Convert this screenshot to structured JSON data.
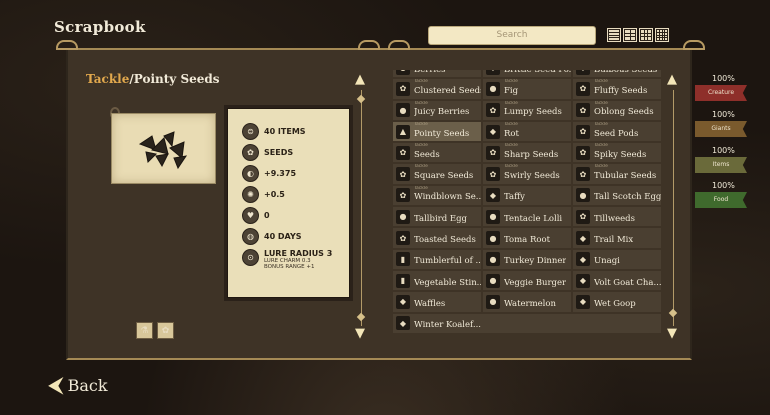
{
  "header": {
    "title": "Scrapbook",
    "search_placeholder": "Search"
  },
  "detail": {
    "category": "Tackle",
    "separator": "/",
    "name": "Pointy Seeds",
    "stats": [
      {
        "icon": "stack-icon",
        "glyph": "⊜",
        "text": "40 ITEMS"
      },
      {
        "icon": "seed-type-icon",
        "glyph": "✿",
        "text": "SEEDS"
      },
      {
        "icon": "hunger-icon",
        "glyph": "◐",
        "text": "+9.375"
      },
      {
        "icon": "sanity-icon",
        "glyph": "✺",
        "text": "+0.5"
      },
      {
        "icon": "health-icon",
        "glyph": "♥",
        "text": "0"
      },
      {
        "icon": "spoil-icon",
        "glyph": "◍",
        "text": "40 DAYS"
      }
    ],
    "lure": {
      "icon": "lure-icon",
      "glyph": "⊙",
      "text": "LURE RADIUS 3",
      "sub1": "LURE CHARM 0.3",
      "sub2": "BONUS RANGE +1"
    }
  },
  "list": {
    "tag": "Tackle",
    "items": [
      {
        "label": "Berries",
        "icon": "berries-icon",
        "glyph": "●"
      },
      {
        "label": "Brittle Seed Po...",
        "icon": "brittle-seed-pod-icon",
        "glyph": "◆"
      },
      {
        "label": "Bulbous Seeds",
        "icon": "bulbous-seeds-icon",
        "glyph": "◆"
      },
      {
        "label": "Clustered Seeds",
        "icon": "clustered-seeds-icon",
        "glyph": "✿"
      },
      {
        "label": "Fig",
        "icon": "fig-icon",
        "glyph": "●"
      },
      {
        "label": "Fluffy Seeds",
        "icon": "fluffy-seeds-icon",
        "glyph": "✿"
      },
      {
        "label": "Juicy Berries",
        "icon": "juicy-berries-icon",
        "glyph": "●"
      },
      {
        "label": "Lumpy Seeds",
        "icon": "lumpy-seeds-icon",
        "glyph": "✿"
      },
      {
        "label": "Oblong Seeds",
        "icon": "oblong-seeds-icon",
        "glyph": "✿"
      },
      {
        "label": "Pointy Seeds",
        "icon": "pointy-seeds-icon",
        "glyph": "▲",
        "selected": true
      },
      {
        "label": "Rot",
        "icon": "rot-icon",
        "glyph": "◆"
      },
      {
        "label": "Seed Pods",
        "icon": "seed-pods-icon",
        "glyph": "✿"
      },
      {
        "label": "Seeds",
        "icon": "seeds-icon",
        "glyph": "✿"
      },
      {
        "label": "Sharp Seeds",
        "icon": "sharp-seeds-icon",
        "glyph": "✿"
      },
      {
        "label": "Spiky Seeds",
        "icon": "spiky-seeds-icon",
        "glyph": "✿"
      },
      {
        "label": "Square Seeds",
        "icon": "square-seeds-icon",
        "glyph": "✿"
      },
      {
        "label": "Swirly Seeds",
        "icon": "swirly-seeds-icon",
        "glyph": "✿"
      },
      {
        "label": "Tubular Seeds",
        "icon": "tubular-seeds-icon",
        "glyph": "✿"
      },
      {
        "label": "Windblown Se...",
        "icon": "windblown-seeds-icon",
        "glyph": "✿"
      },
      {
        "label": "Taffy",
        "icon": "taffy-icon",
        "glyph": "◆",
        "no_tag": true
      },
      {
        "label": "Tall Scotch Eggs",
        "icon": "tall-scotch-eggs-icon",
        "glyph": "●",
        "no_tag": true
      },
      {
        "label": "Tallbird Egg",
        "icon": "tallbird-egg-icon",
        "glyph": "●",
        "no_tag": true
      },
      {
        "label": "Tentacle Lolli",
        "icon": "tentacle-lolli-icon",
        "glyph": "●",
        "no_tag": true
      },
      {
        "label": "Tillweeds",
        "icon": "tillweeds-icon",
        "glyph": "✿",
        "no_tag": true
      },
      {
        "label": "Toasted Seeds",
        "icon": "toasted-seeds-icon",
        "glyph": "✿",
        "no_tag": true
      },
      {
        "label": "Toma Root",
        "icon": "toma-root-icon",
        "glyph": "●",
        "no_tag": true
      },
      {
        "label": "Trail Mix",
        "icon": "trail-mix-icon",
        "glyph": "◆",
        "no_tag": true
      },
      {
        "label": "Tumblerful of ...",
        "icon": "tumblerful-icon",
        "glyph": "▮",
        "no_tag": true
      },
      {
        "label": "Turkey Dinner",
        "icon": "turkey-dinner-icon",
        "glyph": "●",
        "no_tag": true
      },
      {
        "label": "Unagi",
        "icon": "unagi-icon",
        "glyph": "◆",
        "no_tag": true
      },
      {
        "label": "Vegetable Stin...",
        "icon": "vegetable-stinger-icon",
        "glyph": "▮",
        "no_tag": true
      },
      {
        "label": "Veggie Burger",
        "icon": "veggie-burger-icon",
        "glyph": "●",
        "no_tag": true
      },
      {
        "label": "Volt Goat Cha...",
        "icon": "volt-goat-chaud-froid-icon",
        "glyph": "◆",
        "no_tag": true
      },
      {
        "label": "Waffles",
        "icon": "waffles-icon",
        "glyph": "◆",
        "no_tag": true
      },
      {
        "label": "Watermelon",
        "icon": "watermelon-icon",
        "glyph": "●",
        "no_tag": true
      },
      {
        "label": "Wet Goop",
        "icon": "wet-goop-icon",
        "glyph": "◆",
        "no_tag": true
      },
      {
        "label": "Winter Koalef...",
        "icon": "winter-koalefant-icon",
        "glyph": "◆",
        "no_tag": true,
        "wide": true
      }
    ]
  },
  "categories": [
    {
      "label": "Creature",
      "percent": "100%",
      "color": "#8e2f2a"
    },
    {
      "label": "Giants",
      "percent": "100%",
      "color": "#7a5a2d"
    },
    {
      "label": "Items",
      "percent": "100%",
      "color": "#6a6a3a"
    },
    {
      "label": "Food",
      "percent": "100%",
      "color": "#3f6a2d"
    }
  ],
  "footer": {
    "back_label": "Back"
  }
}
